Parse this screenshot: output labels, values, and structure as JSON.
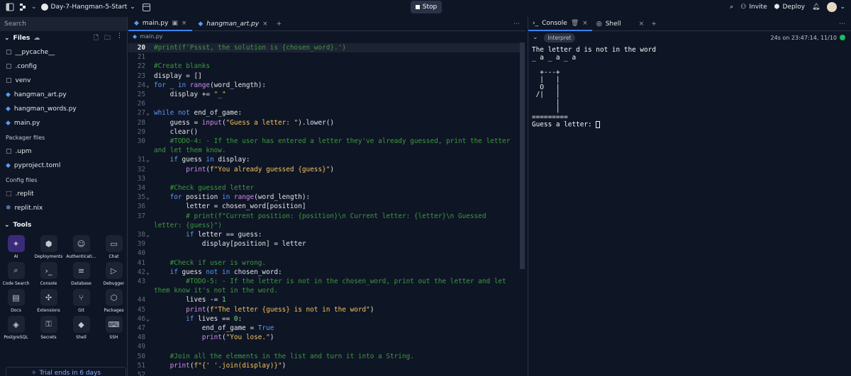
{
  "topbar": {
    "repl_name": "Day-7-Hangman-5-Start",
    "stop_label": "Stop",
    "invite_label": "Invite",
    "deploy_label": "Deploy"
  },
  "sidebar": {
    "search_placeholder": "Search",
    "files_title": "Files",
    "files": [
      {
        "name": "__pycache__",
        "icon": "folder-icon"
      },
      {
        "name": ".config",
        "icon": "folder-icon"
      },
      {
        "name": "venv",
        "icon": "folder-icon"
      },
      {
        "name": "hangman_art.py",
        "icon": "python-icon"
      },
      {
        "name": "hangman_words.py",
        "icon": "python-icon"
      },
      {
        "name": "main.py",
        "icon": "python-icon"
      }
    ],
    "packager_title": "Packager files",
    "packager_files": [
      {
        "name": ".upm",
        "icon": "folder-icon"
      },
      {
        "name": "pyproject.toml",
        "icon": "python-icon"
      }
    ],
    "config_title": "Config files",
    "config_files": [
      {
        "name": ".replit",
        "icon": "replit-icon"
      },
      {
        "name": "replit.nix",
        "icon": "nix-icon"
      }
    ],
    "tools_title": "Tools",
    "tools": [
      {
        "label": "AI",
        "glyph": "✦"
      },
      {
        "label": "Deployments",
        "glyph": "⬢"
      },
      {
        "label": "Authenticati...",
        "glyph": "☺"
      },
      {
        "label": "Chat",
        "glyph": "▭"
      },
      {
        "label": "Code Search",
        "glyph": "⌕"
      },
      {
        "label": "Console",
        "glyph": "›_"
      },
      {
        "label": "Database",
        "glyph": "≡"
      },
      {
        "label": "Debugger",
        "glyph": "▷"
      },
      {
        "label": "Docs",
        "glyph": "▤"
      },
      {
        "label": "Extensions",
        "glyph": "✣"
      },
      {
        "label": "Git",
        "glyph": "⑂"
      },
      {
        "label": "Packages",
        "glyph": "⬡"
      },
      {
        "label": "PostgreSQL",
        "glyph": "◈"
      },
      {
        "label": "Secrets",
        "glyph": "⚿"
      },
      {
        "label": "Shell",
        "glyph": "◆"
      },
      {
        "label": "SSH",
        "glyph": "⌨"
      }
    ],
    "trial_label": "Trial ends in 6 days"
  },
  "editor": {
    "tabs": [
      {
        "label": "main.py"
      },
      {
        "label": "hangman_art.py"
      }
    ],
    "breadcrumb": "main.py",
    "current_line": 20,
    "lines": [
      {
        "n": 20,
        "html": "<span class='cm'>#print(f'Pssst, the solution is {chosen_word}.')</span>"
      },
      {
        "n": 21,
        "html": ""
      },
      {
        "n": 22,
        "html": "<span class='cm'>#Create blanks</span>"
      },
      {
        "n": 23,
        "html": "display = []"
      },
      {
        "n": 24,
        "fold": true,
        "html": "<span class='kw'>for</span> _ <span class='kw'>in</span> <span class='fn'>range</span>(word_length):"
      },
      {
        "n": 25,
        "html": "    display += <span class='st'>\"_\"</span>"
      },
      {
        "n": 26,
        "html": ""
      },
      {
        "n": 27,
        "fold": true,
        "html": "<span class='kw'>while</span> <span class='kw'>not</span> end_of_game:"
      },
      {
        "n": 28,
        "html": "    guess = <span class='fn'>input</span>(<span class='st'>\"Guess a letter: \"</span>).lower()"
      },
      {
        "n": 29,
        "html": "    clear()"
      },
      {
        "n": 30,
        "wrap": 2,
        "html": "    <span class='cm'>#TODO-4: - If the user has entered a letter they've already guessed, print the letter and let them know.</span>"
      },
      {
        "n": 31,
        "fold": true,
        "html": "    <span class='kw'>if</span> guess <span class='kw'>in</span> display:"
      },
      {
        "n": 32,
        "html": "        <span class='fn'>print</span>(<span class='st'>f\"You already guessed {guess}\"</span>)"
      },
      {
        "n": 33,
        "html": ""
      },
      {
        "n": 34,
        "html": "    <span class='cm'>#Check guessed letter</span>"
      },
      {
        "n": 35,
        "fold": true,
        "html": "    <span class='kw'>for</span> position <span class='kw'>in</span> <span class='fn'>range</span>(word_length):"
      },
      {
        "n": 36,
        "html": "        letter = chosen_word[position]"
      },
      {
        "n": 37,
        "wrap": 2,
        "html": "        <span class='cm'># print(f\"Current position: {position}\\n Current letter: {letter}\\n Guessed letter: {guess}\")</span>"
      },
      {
        "n": 38,
        "fold": true,
        "html": "        <span class='kw'>if</span> letter == guess:"
      },
      {
        "n": 39,
        "html": "            display[position] = letter"
      },
      {
        "n": 40,
        "html": ""
      },
      {
        "n": 41,
        "html": "    <span class='cm'>#Check if user is wrong.</span>"
      },
      {
        "n": 42,
        "fold": true,
        "html": "    <span class='kw'>if</span> guess <span class='kw'>not</span> <span class='kw'>in</span> chosen_word:"
      },
      {
        "n": 43,
        "wrap": 2,
        "html": "        <span class='cm'>#TODO-5: - If the letter is not in the chosen_word, print out the letter and let them know it's not in the word.</span>"
      },
      {
        "n": 44,
        "html": "        lives -= <span class='nm'>1</span>"
      },
      {
        "n": 45,
        "html": "        <span class='fn'>print</span>(<span class='st'>f\"The letter {guess} is not in the word\"</span>)"
      },
      {
        "n": 46,
        "fold": true,
        "html": "        <span class='kw'>if</span> lives == <span class='nm'>0</span>:"
      },
      {
        "n": 47,
        "html": "            end_of_game = <span class='kw'>True</span>"
      },
      {
        "n": 48,
        "html": "            <span class='fn'>print</span>(<span class='st'>\"You lose.\"</span>)"
      },
      {
        "n": 49,
        "html": ""
      },
      {
        "n": 50,
        "html": "    <span class='cm'>#Join all the elements in the list and turn it into a String.</span>"
      },
      {
        "n": 51,
        "html": "    <span class='fn'>print</span>(<span class='st'>f\"{' '.join(display)}\"</span>)"
      },
      {
        "n": 52,
        "html": ""
      }
    ]
  },
  "console": {
    "tabs": [
      {
        "label": "Console"
      },
      {
        "label": "Shell"
      }
    ],
    "interpret_label": "Interpret",
    "status": "24s on 23:47:14, 11/10",
    "output": "The letter d is not in the word\n_ a _ a _ a\n\n  +---+\n  |   |\n  O   |\n /|   |\n      |\n      |\n=========\nGuess a letter: "
  }
}
